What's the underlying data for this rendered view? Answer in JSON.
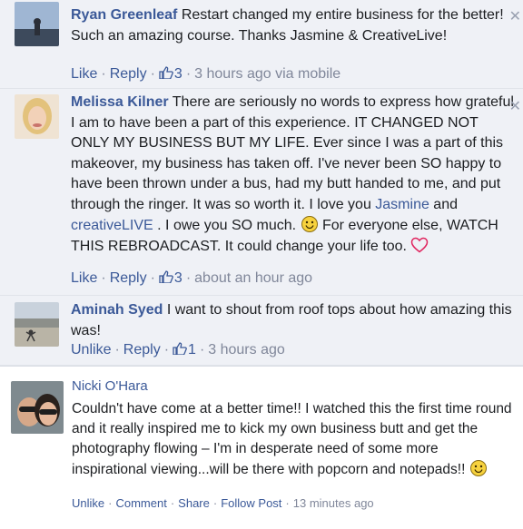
{
  "comments": [
    {
      "author": "Ryan Greenleaf",
      "text": "Restart changed my entire business for the better! Such an amazing course. Thanks Jasmine & CreativeLive!",
      "actions": [
        "Like",
        "Reply"
      ],
      "like_count": "3",
      "timestamp": "3 hours ago via mobile"
    },
    {
      "author": "Melissa Kilner",
      "text_before": "There are seriously no words to express how grateful I am to have been a part of this experience. IT CHANGED NOT ONLY MY BUSINESS BUT MY LIFE. Ever since I was a part of this makeover, my business has taken off. I've never been SO happy to have been thrown under a bus, had my butt handed to me, and put through the ringer. It was so worth it. I love you ",
      "mention_1": "Jasmine",
      "and": " and ",
      "mention_2": "creativeLIVE",
      "text_after": " . I owe you SO much. ",
      "text_tail": " For everyone else, WATCH THIS REBROADCAST. It could change your life too. ",
      "actions": [
        "Like",
        "Reply"
      ],
      "like_count": "3",
      "timestamp": "about an hour ago"
    },
    {
      "author": "Aminah Syed",
      "text": "I want to shout from roof tops about how amazing this was!",
      "actions": [
        "Unlike",
        "Reply"
      ],
      "like_count": "1",
      "timestamp": "3 hours ago"
    },
    {
      "author": "Nicki O'Hara",
      "text": "Couldn't have come at a better time!! I watched this the first time round and it really inspired me to kick my own business butt and get the photography flowing – I'm in desperate need of some more inspirational viewing...will be there with popcorn and notepads!! ",
      "actions": [
        "Unlike",
        "Comment",
        "Share",
        "Follow Post"
      ],
      "timestamp": "13 minutes ago"
    }
  ],
  "icons": {
    "close": "close-icon",
    "like": "thumbs-up-icon",
    "smiley": "smiley-emoji-icon",
    "heart": "heart-emoji-icon"
  },
  "colors": {
    "link": "#3b5998",
    "meta": "#80879a",
    "comment_bg": "#eff1f6",
    "heart": "#e0245e",
    "smiley": "#f7d23e"
  }
}
